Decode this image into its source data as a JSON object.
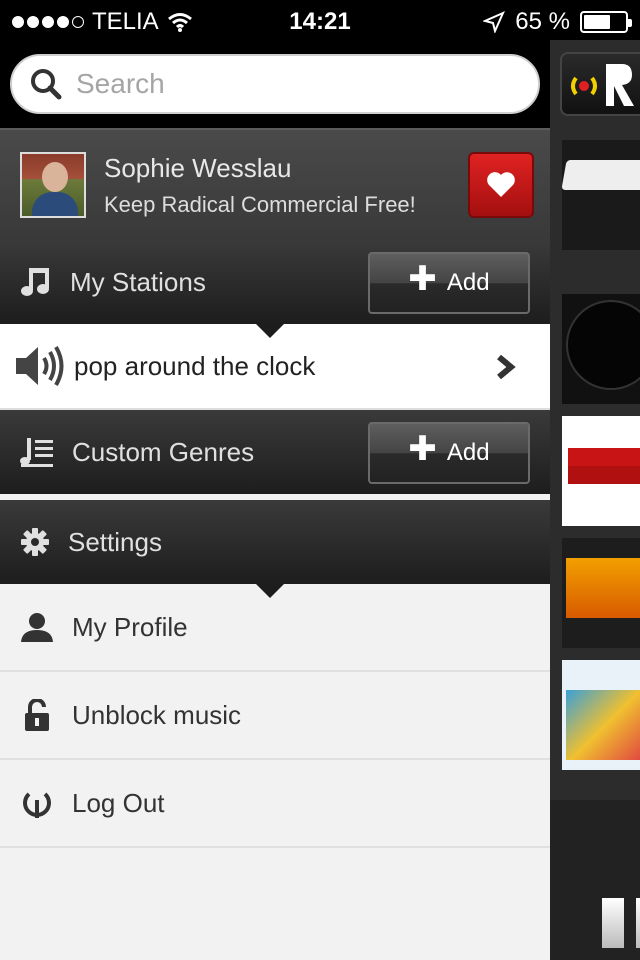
{
  "status": {
    "carrier": "TELIA",
    "time": "14:21",
    "battery": "65 %",
    "battery_level": 0.65
  },
  "search": {
    "placeholder": "Search"
  },
  "profile": {
    "name": "Sophie Wesslau",
    "subtitle": "Keep Radical Commercial Free!"
  },
  "my_stations": {
    "label": "My Stations",
    "add_label": "Add",
    "items": [
      {
        "label": "pop around the clock"
      }
    ]
  },
  "custom_genres": {
    "label": "Custom Genres",
    "add_label": "Add"
  },
  "settings": {
    "label": "Settings",
    "items": [
      {
        "label": "My Profile",
        "icon": "person-icon"
      },
      {
        "label": "Unblock music",
        "icon": "unlock-icon"
      },
      {
        "label": "Log Out",
        "icon": "logout-icon"
      }
    ]
  },
  "colors": {
    "accent_red": "#c81414",
    "dark_header": "#1d1d1d"
  }
}
